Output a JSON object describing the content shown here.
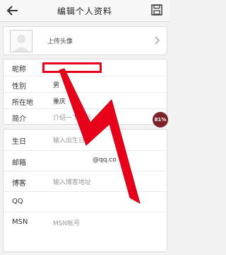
{
  "header": {
    "title": "编辑个人资料"
  },
  "avatar_row": {
    "label": "上传头像"
  },
  "basic_info": [
    {
      "label": "昵称",
      "value": "",
      "placeholder": ""
    },
    {
      "label": "性别",
      "value": "男",
      "placeholder": ""
    },
    {
      "label": "所在地",
      "value": "重庆",
      "placeholder": ""
    },
    {
      "label": "简介",
      "value": "",
      "placeholder": "介绍一下自己"
    }
  ],
  "contact_info": [
    {
      "label": "生日",
      "placeholder": "输入出生日",
      "suffix": ""
    },
    {
      "label": "邮箱",
      "placeholder": "",
      "suffix": "@qq.co"
    },
    {
      "label": "博客",
      "placeholder": "输入博客地址",
      "suffix": ""
    },
    {
      "label": "QQ",
      "placeholder": "",
      "suffix": ""
    },
    {
      "label": "MSN",
      "placeholder": "MSN帐号",
      "suffix": ""
    }
  ],
  "badge": {
    "text": "81%"
  },
  "colors": {
    "accent_red": "#e8001b",
    "badge_bg": "#7a2227"
  }
}
